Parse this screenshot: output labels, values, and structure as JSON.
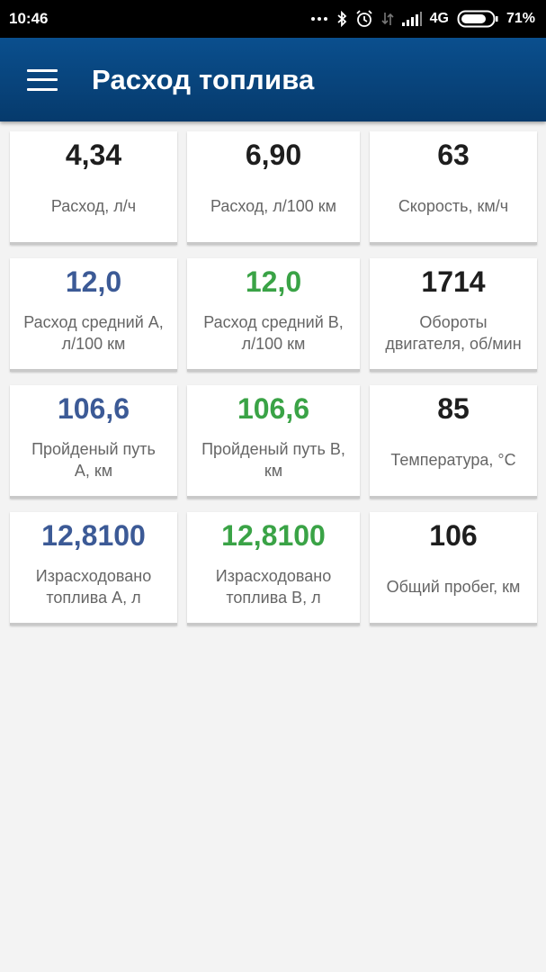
{
  "status_bar": {
    "time": "10:46",
    "network": "4G",
    "battery": "71%",
    "icons": [
      "more-dots-icon",
      "bluetooth-icon",
      "alarm-icon",
      "data-arrows-icon",
      "signal-icon",
      "battery-icon"
    ]
  },
  "app_bar": {
    "title": "Расход топлива",
    "menu_icon": "hamburger-menu-icon"
  },
  "colors": {
    "appbar": "#084676",
    "value_default": "#1e1e1e",
    "value_a": "#3c5a96",
    "value_b": "#3aa346",
    "label": "#666666"
  },
  "tiles": [
    {
      "value": "4,34",
      "label": "Расход, л/ч",
      "color": "black"
    },
    {
      "value": "6,90",
      "label": "Расход, л/100 км",
      "color": "black"
    },
    {
      "value": "63",
      "label": "Скорость, км/ч",
      "color": "black"
    },
    {
      "value": "12,0",
      "label": "Расход средний А,\nл/100 км",
      "color": "blue"
    },
    {
      "value": "12,0",
      "label": "Расход средний В,\nл/100 км",
      "color": "green"
    },
    {
      "value": "1714",
      "label": "Обороты\nдвигателя, об/мин",
      "color": "black"
    },
    {
      "value": "106,6",
      "label": "Пройденый путь\nА, км",
      "color": "blue"
    },
    {
      "value": "106,6",
      "label": "Пройденый путь В,\nкм",
      "color": "green"
    },
    {
      "value": "85",
      "label": "Температура, °С",
      "color": "black"
    },
    {
      "value": "12,8100",
      "label": "Израсходовано\nтоплива А, л",
      "color": "blue"
    },
    {
      "value": "12,8100",
      "label": "Израсходовано\nтоплива В, л",
      "color": "green"
    },
    {
      "value": "106",
      "label": "Общий пробег, км",
      "color": "black"
    }
  ]
}
